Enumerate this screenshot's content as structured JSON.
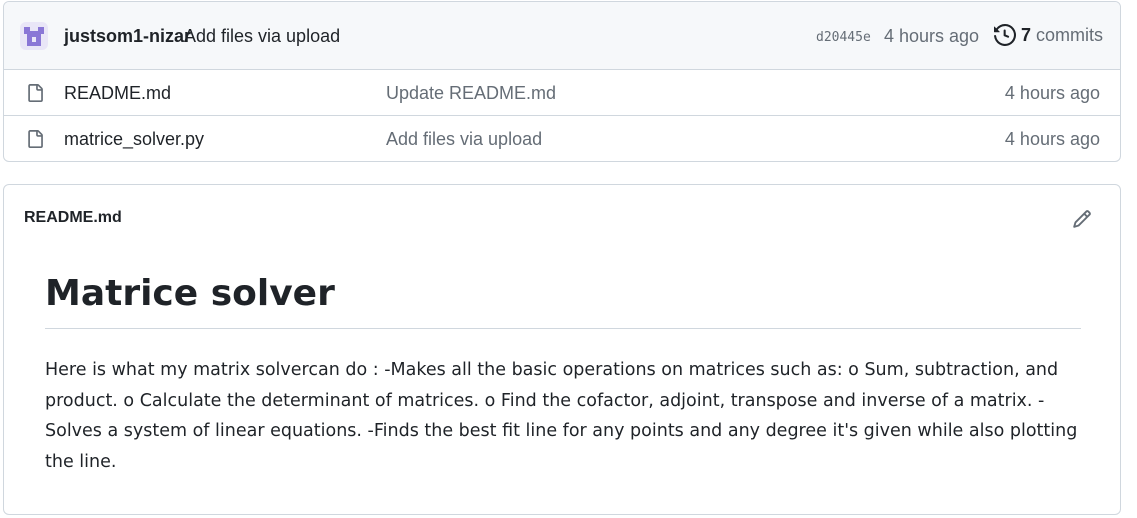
{
  "latest_commit": {
    "author": "justsom1-nizar",
    "message": "Add files via upload",
    "sha": "d20445e",
    "time": "4 hours ago",
    "commits_count": "7",
    "commits_label": "commits"
  },
  "files": [
    {
      "name": "README.md",
      "commit_message": "Update README.md",
      "time": "4 hours ago",
      "icon": "file-icon"
    },
    {
      "name": "matrice_solver.py",
      "commit_message": "Add files via upload",
      "time": "4 hours ago",
      "icon": "file-icon"
    }
  ],
  "readme": {
    "filename": "README.md",
    "heading": "Matrice solver",
    "body": "Here is what my matrix solvercan do : -Makes all the basic operations on matrices such as: o Sum, subtraction, and product. o Calculate the determinant of matrices. o Find the cofactor, adjoint, transpose and inverse of a matrix. -Solves a system of linear equations. -Finds the best fit line for any points and any degree it's given while also plotting the line."
  },
  "colors": {
    "border": "#d0d7de",
    "header_bg": "#f6f8fa",
    "muted_text": "#656d76",
    "avatar": "#8a77d6"
  }
}
